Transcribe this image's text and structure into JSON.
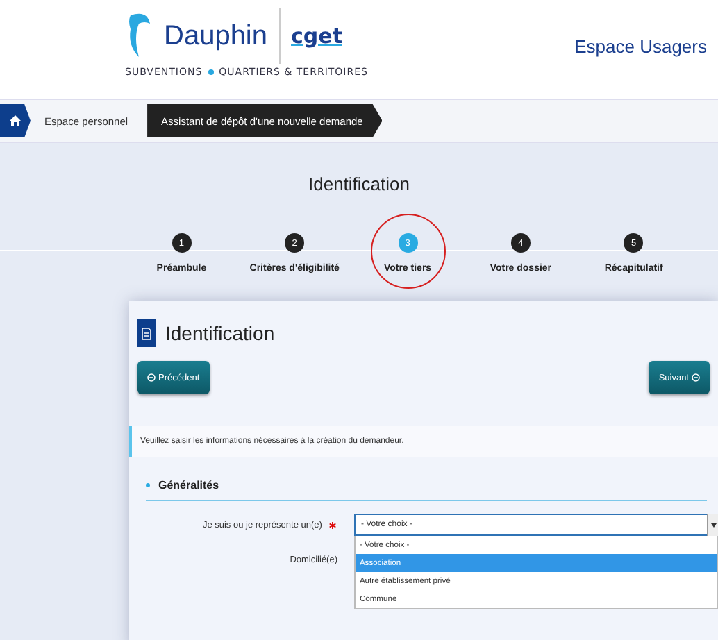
{
  "header": {
    "logo_text": "Dauphin",
    "partner_logo": "cget",
    "tagline": [
      "SUBVENTIONS",
      "QUARTIERS & TERRITOIRES"
    ],
    "space": "Espace Usagers"
  },
  "breadcrumb": [
    {
      "label": "Espace personnel",
      "selected": false
    },
    {
      "label": "Assistant de dépôt d'une nouvelle demande",
      "selected": true
    }
  ],
  "page_title": "Identification",
  "steps": [
    {
      "number": "1",
      "label": "Préambule",
      "selected": false
    },
    {
      "number": "2",
      "label": "Critères d'éligibilité",
      "selected": false
    },
    {
      "number": "3",
      "label": "Votre tiers",
      "selected": true
    },
    {
      "number": "4",
      "label": "Votre dossier",
      "selected": false
    },
    {
      "number": "5",
      "label": "Récapitulatif",
      "selected": false
    }
  ],
  "card": {
    "title": "Identification",
    "prev_button": "Précédent",
    "next_button": "Suivant",
    "info": "Veuillez saisir les informations nécessaires à la création du demandeur.",
    "section": "Généralités",
    "fields": [
      {
        "label": "Je suis ou je représente un(e)",
        "required": true,
        "value": "- Votre choix -",
        "expanded": true,
        "options": [
          {
            "label": "- Votre choix -",
            "highlighted": false
          },
          {
            "label": "Association",
            "highlighted": true
          },
          {
            "label": "Autre établissement privé",
            "highlighted": false
          },
          {
            "label": "Commune",
            "highlighted": false
          }
        ]
      },
      {
        "label": "Domicilié(e)",
        "required": false
      }
    ]
  }
}
